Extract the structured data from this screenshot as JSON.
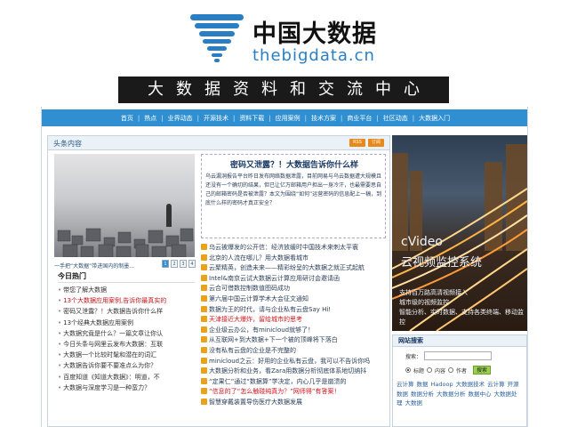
{
  "header": {
    "logo_cn": "中国大数据",
    "logo_en": "thebigdata.cn",
    "banner": "大数据资料和交流中心"
  },
  "nav": {
    "items": [
      "首页",
      "热点",
      "业界动态",
      "开源技术",
      "资料下载",
      "应用案例",
      "技术方案",
      "商业平台",
      "社区动态",
      "大数据入门"
    ]
  },
  "main": {
    "title": "头条内容",
    "rss": [
      "RSS",
      "订阅"
    ],
    "photo_caption": "一手把“大数据”带进国内的制墨...",
    "pager": [
      "1",
      "2",
      "3",
      "4"
    ],
    "feature": {
      "title": "密码又泄露？！大数据告诉你什么样",
      "body": "乌云漏洞报告平台昨日发布网络数据泄露，目前网易与乌云数据遭大规模且还没有一个确切的结果，但已让亿万邮箱用户担出一身冷汗，也最需要思自己的邮箱密码是否被泄露？本文为围绕“如何”运营密码的信息配上一稿，到底什么样的密码才真正安全？"
    },
    "news": [
      {
        "text": "乌云被爆发的公开信：经济放缓时中国技术来刺太平寰",
        "red": false
      },
      {
        "text": "北京的人流在哪儿？用大数据看城市",
        "red": false
      },
      {
        "text": "云聚精英，创造未来——精彩纷呈的大数据之就正式起航",
        "red": false
      },
      {
        "text": "Intel&南京云试大数据云计算应用研讨会邀请函",
        "red": false
      },
      {
        "text": "云合可借数控制数值图码成功",
        "red": false
      },
      {
        "text": "第六届中国云计算学术大会征文通知",
        "red": false
      },
      {
        "text": "数据为王的时代，请与企业私有云盘Say Hi!",
        "red": false
      },
      {
        "text": "天津接近大爆炸，留给城市的思考",
        "red": true
      },
      {
        "text": "企业级云办公，有minicloud就够了！",
        "red": false
      },
      {
        "text": "从互联网+到大数据+下一个被的顶峰将下落白",
        "red": false
      },
      {
        "text": "没有私有云盘的企业是不完整的",
        "red": false
      },
      {
        "text": "minicloud之云：好用的企业私有云盘，我可以不告诉你吗",
        "red": false
      },
      {
        "text": "大数据分析和业务，看Zara用数据分析彻底体系地切纳抖",
        "red": false
      },
      {
        "text": "“定果仁”通过“数据算”学决定，内心几乎是崩溃的",
        "red": false
      },
      {
        "text": "“信息的了“怎么触碰纯真为？”网师得”有答案！",
        "red": true
      },
      {
        "text": "智慧穿戴装置导伤医疗大数据发展",
        "red": false
      }
    ]
  },
  "today": {
    "title": "今日热门",
    "items": [
      {
        "text": "带您了解大数据",
        "red": false
      },
      {
        "text": "13个大数据应用案例,告诉你最真实的",
        "red": true
      },
      {
        "text": "密码又泄露？！大数据告诉你什么样",
        "red": false
      },
      {
        "text": "13个经典大数据应用案例",
        "red": false
      },
      {
        "text": "大数据究竟是什么？一篇文章让你认",
        "red": false
      },
      {
        "text": "今日头条与网里云发布大数据：互联",
        "red": false
      },
      {
        "text": "大数据一个比较时髦和潜在的词汇",
        "red": false
      },
      {
        "text": "大数据告诉你要不要准点么为你？",
        "red": false
      },
      {
        "text": "百度知道《知道大数据》：明道，不",
        "red": false
      },
      {
        "text": "大数据与深度学习是一种蛮力？",
        "red": false
      }
    ]
  },
  "video_ad": {
    "title_en": "cVideo",
    "title_cn": "云视频监控系统",
    "desc": "支持百万路高清视频接入\n城市级的视频监控\n智能分析、实时数据、支持各类终端、移动监控"
  },
  "search": {
    "title": "网站搜索",
    "label": "搜索：",
    "radios": [
      "标题",
      "内容",
      "作者"
    ],
    "selected": "标题",
    "button": "搜索",
    "tags": [
      "云计算",
      "数据",
      "Hadoop",
      "大数据技术",
      "云计算",
      "开源数据",
      "数据分析",
      "大数据分析",
      "数据中心",
      "大数据处理",
      "大数据"
    ]
  },
  "colors": {
    "nav_blue": "#2f8fd1",
    "red_link": "#c0141a",
    "logo_blue": "#2a7fc4"
  }
}
